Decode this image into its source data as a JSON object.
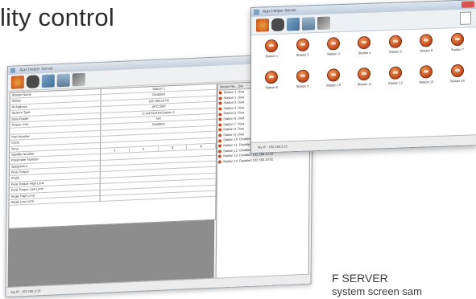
{
  "page": {
    "heading": "lity control",
    "caption_line1": "F SERVER",
    "caption_line2": "system screen sam"
  },
  "colors": {
    "station_icon": "#c24a20",
    "grey_panel": "#8d8d8d",
    "titlebar": "#c3cfdb"
  },
  "back_window": {
    "title": "Ajax Helper Server",
    "toolbar_icons": [
      "station-icon",
      "binoculars-icon",
      "tools-icon",
      "monitor-icon",
      "network-icon"
    ],
    "properties": [
      {
        "label": "Station Name",
        "value": "Station 1"
      },
      {
        "label": "Status",
        "value": "Disabled"
      },
      {
        "label": "IP Address",
        "value": "192.168.10.02"
      },
      {
        "label": "System Type",
        "value": "AFC1500"
      },
      {
        "label": "Data Folder",
        "value": "C:\\AFCDATA\\Station 1"
      },
      {
        "label": "Torque Unit",
        "value": "Nm"
      },
      {
        "label": "",
        "value": "Disabled"
      },
      {
        "label": "Part Number",
        "value": ""
      },
      {
        "label": "Cycle",
        "value": ""
      },
      {
        "label": "Time",
        "value": ""
      },
      {
        "label": "Spindle Number",
        "value": "",
        "cells": [
          "1",
          "2",
          "3",
          "4"
        ]
      },
      {
        "label": "Parameter Number",
        "value": ""
      },
      {
        "label": "Judgement",
        "value": ""
      },
      {
        "label": "Final Torque",
        "value": ""
      },
      {
        "label": "Angle",
        "value": ""
      },
      {
        "label": "Final Torque High Limit",
        "value": ""
      },
      {
        "label": "Final Torque Low Limit",
        "value": ""
      },
      {
        "label": "Angle High Limit",
        "value": ""
      },
      {
        "label": "Angle Low Limit",
        "value": ""
      }
    ],
    "station_list_header": "Station Na... Sta",
    "stations": [
      {
        "name": "Station 1",
        "status": "Disa"
      },
      {
        "name": "Station 2",
        "status": "Disa"
      },
      {
        "name": "Station 3",
        "status": "Disa"
      },
      {
        "name": "Station 4",
        "status": "Disa"
      },
      {
        "name": "Station 5",
        "status": "Disa"
      },
      {
        "name": "Station 6",
        "status": "Disa"
      },
      {
        "name": "Station 7",
        "status": "Disa"
      },
      {
        "name": "Station 8",
        "status": "Disa"
      },
      {
        "name": "Station 9",
        "status": "Disa"
      },
      {
        "name": "Station 10",
        "status": "Disabled 192.168.10.02"
      },
      {
        "name": "Station 11",
        "status": "Disabled 192.168.10.02"
      },
      {
        "name": "Station 12",
        "status": "Disabled 192.168.10.02"
      },
      {
        "name": "Station 13",
        "status": "Disabled 192.168.10.02"
      },
      {
        "name": "Station 14",
        "status": "Disabled 192.168.10.02"
      }
    ],
    "status_bar": "My IP : 192.168.3.10"
  },
  "front_window": {
    "title": "Ajax Helper Server",
    "toolbar_icons": [
      "station-icon",
      "binoculars-icon",
      "tools-icon",
      "monitor-icon",
      "network-icon"
    ],
    "stations": [
      "Station 1",
      "Station 2",
      "Station 3",
      "Station 4",
      "Station 5",
      "Station 6",
      "Station 7",
      "Station 8",
      "Station 9",
      "Station 10",
      "Station 11",
      "Station 12",
      "Station 13",
      "Station 14"
    ],
    "status_bar": "My IP : 192.168.3.10"
  }
}
